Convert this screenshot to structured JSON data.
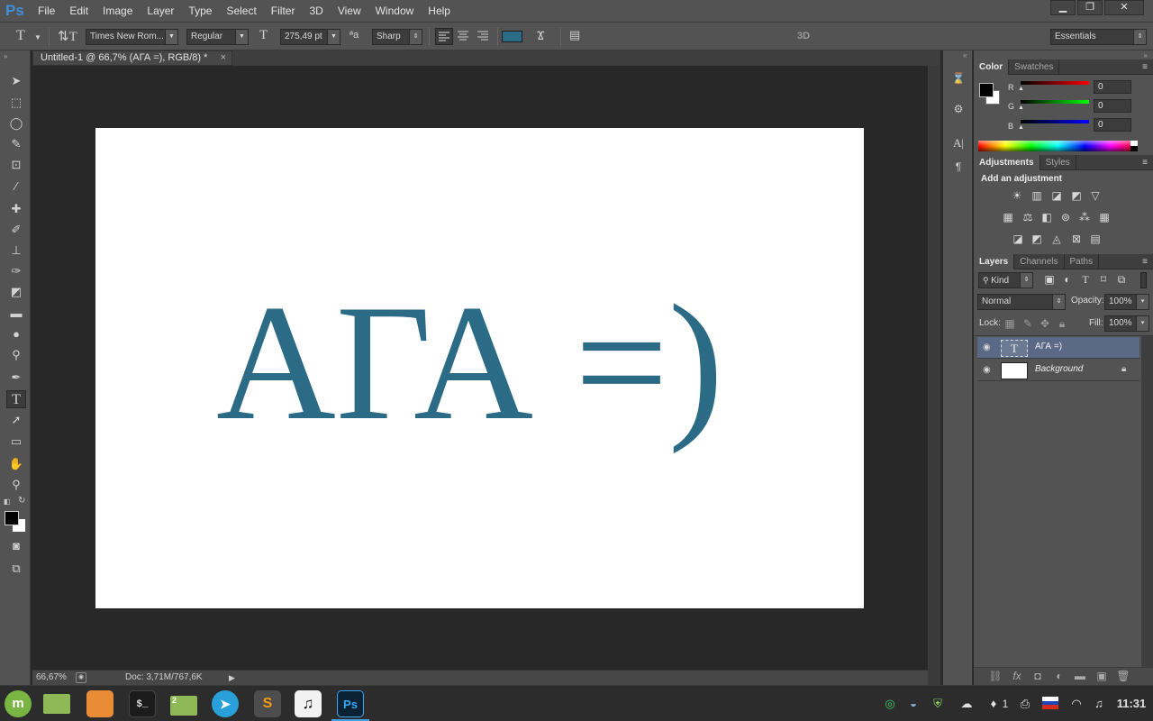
{
  "app": {
    "logo": "Ps",
    "menu": [
      "File",
      "Edit",
      "Image",
      "Layer",
      "Type",
      "Select",
      "Filter",
      "3D",
      "View",
      "Window",
      "Help"
    ],
    "window_controls": {
      "minimize": "▁",
      "restore": "❐",
      "close": "✕"
    }
  },
  "options_bar": {
    "font_family": "Times New Rom...",
    "font_style": "Regular",
    "font_size": "275,49 pt",
    "antialias_label": "ªa",
    "antialias": "Sharp",
    "text_color": "#2c6b86",
    "threed_label": "3D",
    "workspace": "Essentials"
  },
  "document": {
    "tab_title": "Untitled-1 @ 66,7% (АГА =), RGB/8) *",
    "tab_close": "×",
    "canvas_text": "АГА =)",
    "canvas_text_color": "#2c6b86"
  },
  "status_bar": {
    "zoom": "66,67%",
    "doc_size": "Doc: 3,71M/767,6K"
  },
  "color_panel": {
    "tabs": [
      "Color",
      "Swatches"
    ],
    "channels": [
      {
        "label": "R",
        "value": "0"
      },
      {
        "label": "G",
        "value": "0"
      },
      {
        "label": "B",
        "value": "0"
      }
    ],
    "foreground": "#000000",
    "background": "#ffffff"
  },
  "adjustments_panel": {
    "tabs": [
      "Adjustments",
      "Styles"
    ],
    "heading": "Add an adjustment"
  },
  "layers_panel": {
    "tabs": [
      "Layers",
      "Channels",
      "Paths"
    ],
    "filter_kind": "Kind",
    "blend_mode": "Normal",
    "opacity_label": "Opacity:",
    "opacity": "100%",
    "lock_label": "Lock:",
    "fill_label": "Fill:",
    "fill": "100%",
    "layers": [
      {
        "name": "АГА =)",
        "type": "text",
        "thumb_glyph": "T",
        "selected": true
      },
      {
        "name": "Background",
        "type": "background",
        "selected": false
      }
    ]
  },
  "taskbar": {
    "apps": [
      {
        "name": "mint-menu",
        "glyph": "m"
      },
      {
        "name": "files",
        "glyph": ""
      },
      {
        "name": "firefox",
        "glyph": ""
      },
      {
        "name": "terminal",
        "glyph": "$_"
      },
      {
        "name": "file-manager",
        "glyph": "2",
        "badge": "2"
      },
      {
        "name": "telegram",
        "glyph": "➤"
      },
      {
        "name": "sublime-text",
        "glyph": "S"
      },
      {
        "name": "music",
        "glyph": "♫"
      },
      {
        "name": "photoshop",
        "glyph": "Ps"
      }
    ],
    "notification_count": "1",
    "clock": "11:31"
  }
}
